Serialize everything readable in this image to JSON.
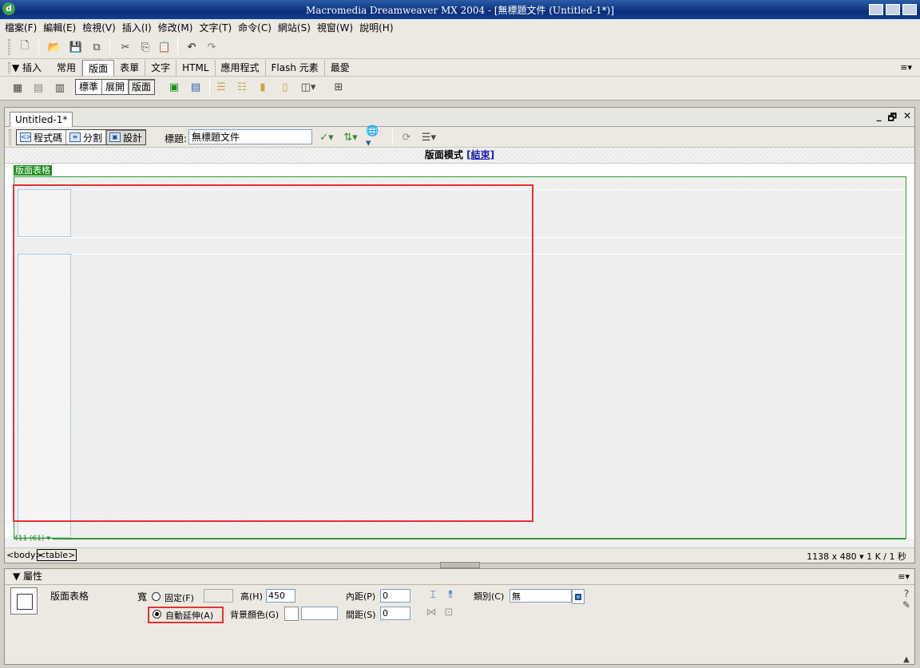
{
  "window": {
    "title": "Macromedia Dreamweaver MX 2004 - [無標題文件 (Untitled-1*)]"
  },
  "menu": [
    "檔案(F)",
    "編輯(E)",
    "檢視(V)",
    "插入(I)",
    "修改(M)",
    "文字(T)",
    "命令(C)",
    "網站(S)",
    "視窗(W)",
    "說明(H)"
  ],
  "insert_bar": {
    "title": "▼ 插入",
    "tabs": [
      "常用",
      "版面",
      "表單",
      "文字",
      "HTML",
      "應用程式",
      "Flash 元素",
      "最愛"
    ],
    "active_tab": "版面",
    "mode_buttons": [
      "標準",
      "展開",
      "版面"
    ],
    "active_mode": "版面"
  },
  "document": {
    "tab": "Untitled-1*",
    "window_controls": [
      "_",
      "🗗",
      "✕"
    ],
    "view_buttons": [
      "程式碼",
      "分割",
      "設計"
    ],
    "active_view": "設計",
    "title_label": "標題:",
    "title_value": "無標題文件",
    "layout_mode_label": "版面模式",
    "layout_mode_exit": "[結束]",
    "layout_table_label": "版面表格",
    "width_indicator": "411 (61) ▾"
  },
  "status_bar": {
    "tag_body": "<body>",
    "tag_table": "<table>",
    "doc_size": "1138 x 480 ▾ 1 K / 1 秒"
  },
  "properties": {
    "header": "▼ 屬性",
    "element_type": "版面表格",
    "width_label": "寬",
    "fixed_label": "固定(F)",
    "autostretch_label": "自動延伸(A)",
    "width_mode": "autostretch",
    "height_label": "高(H)",
    "height_value": "450",
    "bgcolor_label": "背景顏色(G)",
    "padding_label": "內距(P)",
    "padding_value": "0",
    "spacing_label": "間距(S)",
    "spacing_value": "0",
    "class_label": "類別(C)",
    "class_value": "無"
  },
  "colors": {
    "highlight": "#e33232",
    "layout_green": "#1b8c1b",
    "cell_border": "#5ea5da"
  }
}
